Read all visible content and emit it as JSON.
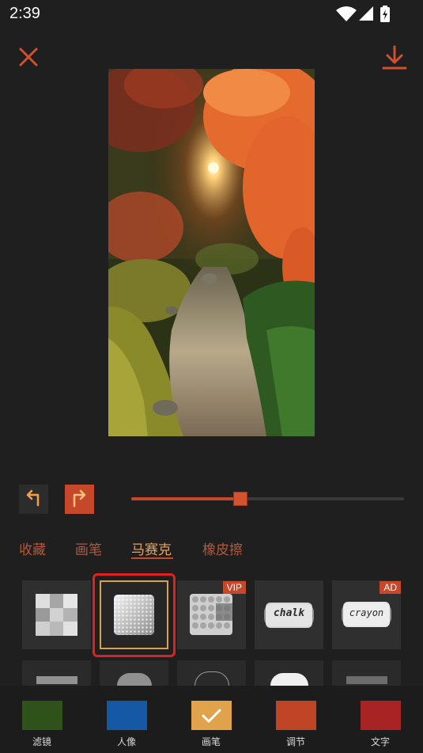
{
  "status_bar": {
    "time": "2:39",
    "icons": [
      "wifi-icon",
      "cell-signal-icon",
      "battery-charging-icon"
    ]
  },
  "toolbar": {
    "close_icon": "close-icon",
    "download_icon": "download-icon"
  },
  "editor": {
    "undo_icon": "undo-icon",
    "redo_icon": "redo-icon",
    "brush_size_level": 0.4
  },
  "tabs": [
    {
      "label": "收藏",
      "active": false
    },
    {
      "label": "画笔",
      "active": false
    },
    {
      "label": "马赛克",
      "active": true
    },
    {
      "label": "橡皮擦",
      "active": false
    }
  ],
  "brushes": [
    {
      "icon": "pixel-mosaic-icon",
      "badge": ""
    },
    {
      "icon": "gradient-mosaic-icon",
      "badge": "",
      "selected": true
    },
    {
      "icon": "lego-mosaic-icon",
      "badge": "VIP"
    },
    {
      "icon": "chalk-brush-icon",
      "label": "chalk",
      "badge": ""
    },
    {
      "icon": "crayon-brush-icon",
      "label": "crayon",
      "badge": "AD"
    }
  ],
  "bottom_nav": [
    {
      "label": "滤镜",
      "color": "#2e5219"
    },
    {
      "label": "人像",
      "color": "#1559a5"
    },
    {
      "label": "画笔",
      "color": "#e0a24a",
      "active": true
    },
    {
      "label": "调节",
      "color": "#c04527"
    },
    {
      "label": "文字",
      "color": "#a82323"
    }
  ],
  "colors": {
    "accent": "#c5482a",
    "background": "#1f1f1f",
    "selection_red": "#e02121",
    "selection_gold": "#d9a24a"
  }
}
